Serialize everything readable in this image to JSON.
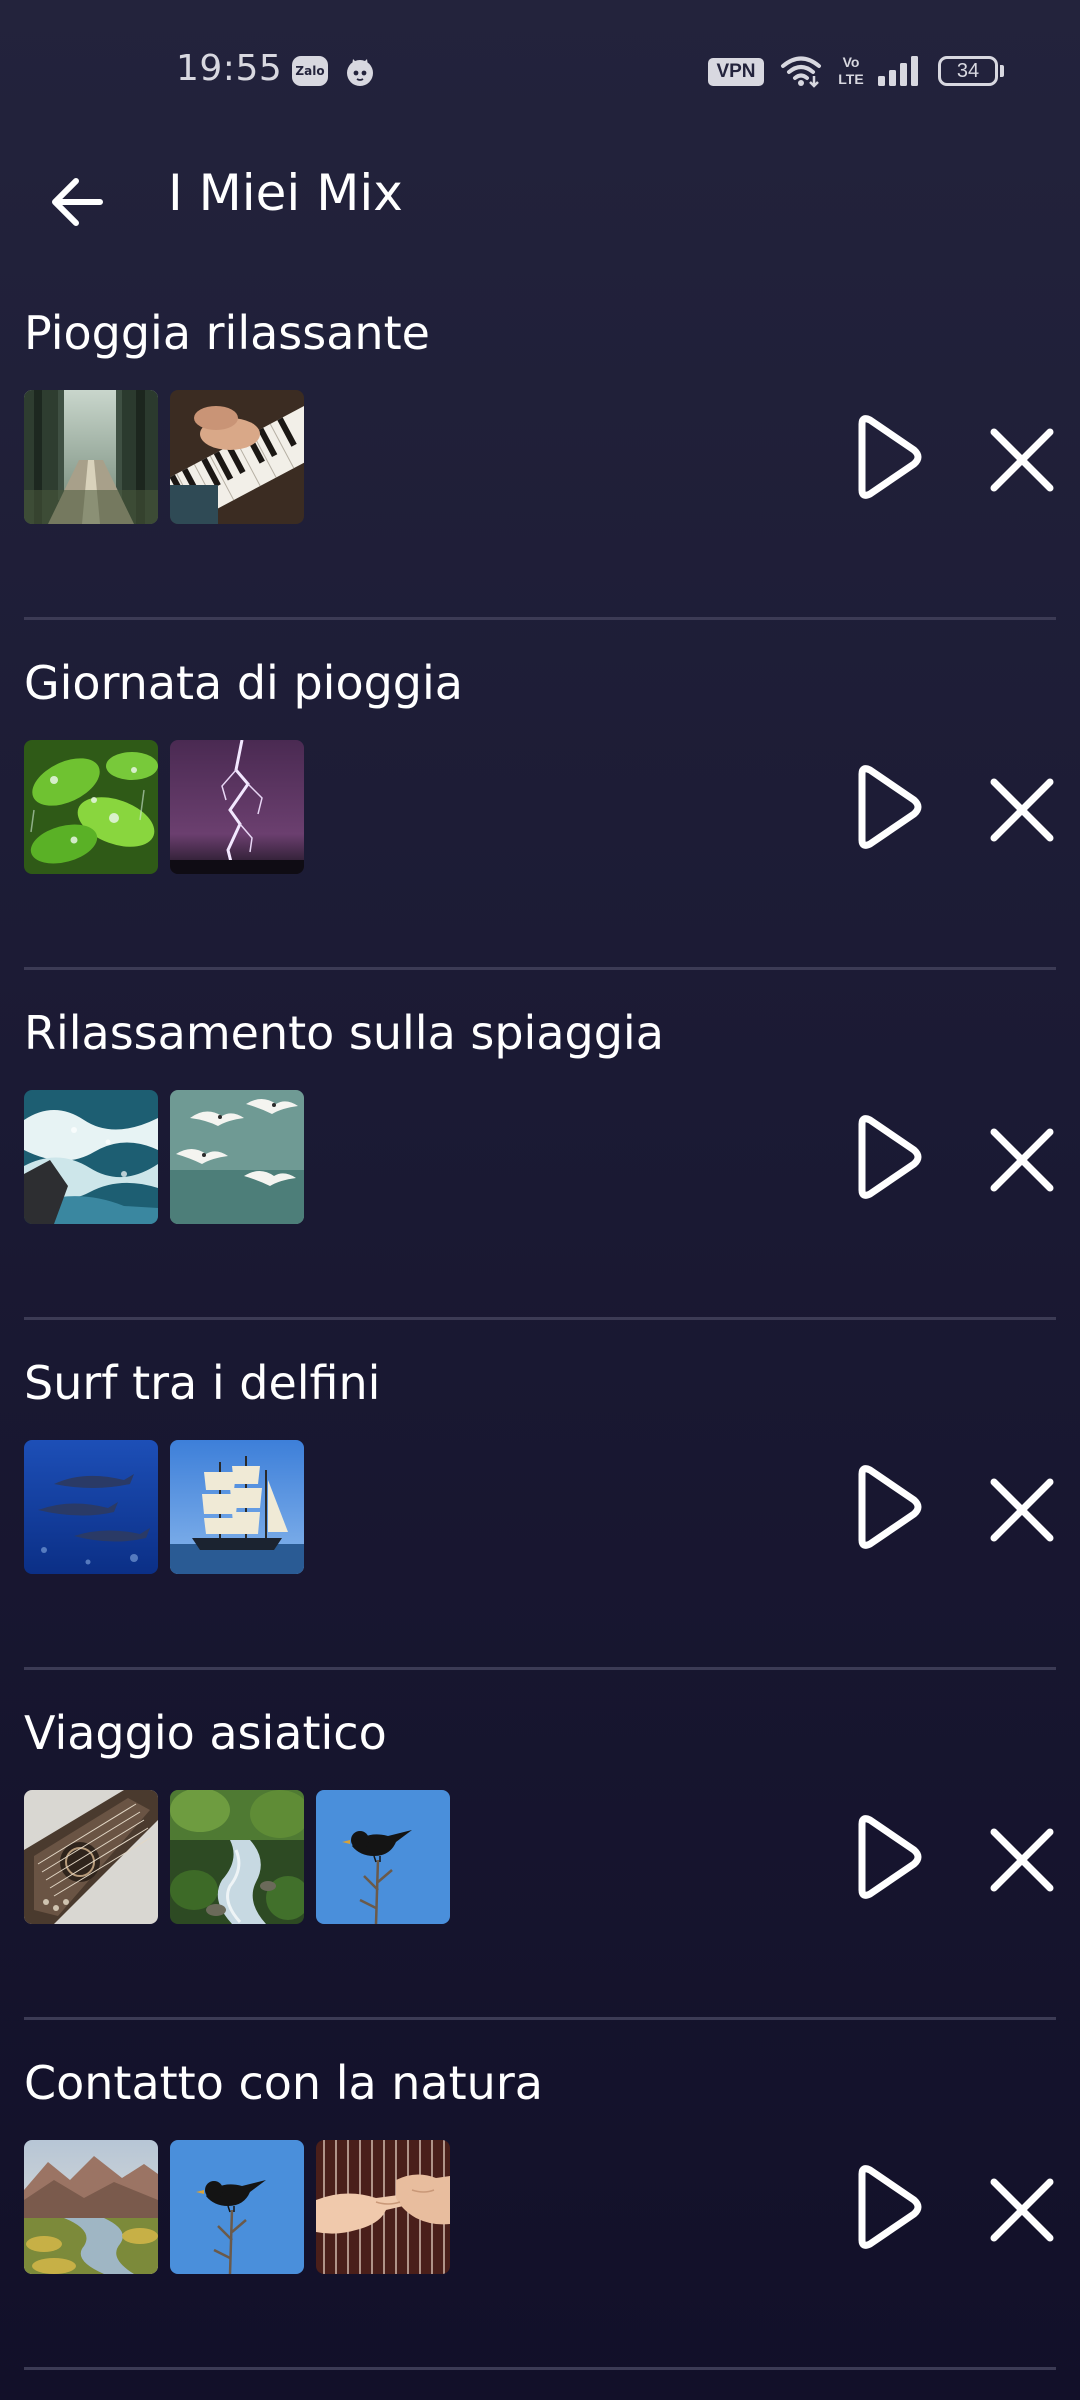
{
  "status_bar": {
    "time": "19:55",
    "zalo_label": "Zalo",
    "vpn_label": "VPN",
    "volte_label": "Vo\nLTE",
    "battery_level": "34",
    "icon_color": "#d8d8e0"
  },
  "header": {
    "title": "I Miei Mix",
    "back_icon": "arrow-left-icon"
  },
  "mixes": [
    {
      "title": "Pioggia rilassante",
      "thumbnails": [
        "forest-road",
        "piano-hands"
      ]
    },
    {
      "title": "Giornata di pioggia",
      "thumbnails": [
        "green-leaves-rain",
        "lightning"
      ]
    },
    {
      "title": "Rilassamento sulla spiaggia",
      "thumbnails": [
        "ocean-waves",
        "seagulls"
      ]
    },
    {
      "title": "Surf tra i delfini",
      "thumbnails": [
        "dolphins",
        "sailing-ship"
      ]
    },
    {
      "title": "Viaggio asiatico",
      "thumbnails": [
        "zither",
        "forest-stream",
        "blackbird"
      ]
    },
    {
      "title": "Contatto con la natura",
      "thumbnails": [
        "mountain-river",
        "blackbird",
        "harp-hands"
      ]
    }
  ],
  "actions": {
    "play_icon": "play-icon",
    "close_icon": "close-icon"
  },
  "colors": {
    "background_top": "#23233c",
    "background_bottom": "#121029",
    "divider": "#3c3b55",
    "text": "#ffffff"
  }
}
